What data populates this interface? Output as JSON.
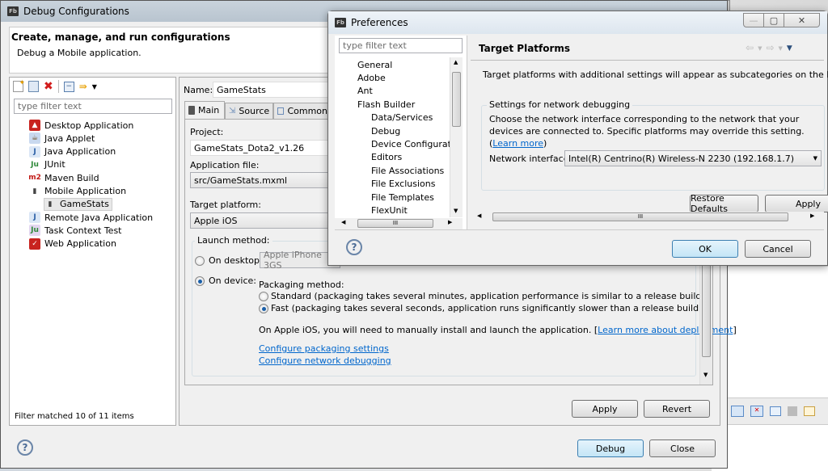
{
  "debug_window": {
    "title": "Debug Configurations",
    "header_title": "Create, manage, and run configurations",
    "header_subtitle": "Debug a Mobile application.",
    "filter_placeholder": "type filter text",
    "toolbar_icons": [
      "new-config-icon",
      "duplicate-icon",
      "delete-icon",
      "collapse-all-icon",
      "filter-icon",
      "dropdown-icon"
    ],
    "tree": [
      {
        "label": "Desktop Application",
        "icon": "desktop-app-icon",
        "level": 0
      },
      {
        "label": "Java Applet",
        "icon": "java-applet-icon",
        "level": 0
      },
      {
        "label": "Java Application",
        "icon": "java-app-icon",
        "level": 0
      },
      {
        "label": "JUnit",
        "icon": "junit-icon",
        "level": 0
      },
      {
        "label": "Maven Build",
        "icon": "maven-icon",
        "level": 0
      },
      {
        "label": "Mobile Application",
        "icon": "mobile-app-icon",
        "level": 0
      },
      {
        "label": "GameStats",
        "icon": "mobile-app-icon",
        "level": 1,
        "selected": true
      },
      {
        "label": "Remote Java Application",
        "icon": "remote-java-icon",
        "level": 0
      },
      {
        "label": "Task Context Test",
        "icon": "task-context-icon",
        "level": 0
      },
      {
        "label": "Web Application",
        "icon": "web-app-icon",
        "level": 0
      }
    ],
    "filter_status": "Filter matched 10 of 11 items",
    "name_label": "Name:",
    "name_value": "GameStats",
    "tabs": [
      {
        "label": "Main",
        "active": true
      },
      {
        "label": "Source",
        "active": false
      },
      {
        "label": "Common",
        "active": false
      }
    ],
    "project_label": "Project:",
    "project_value": "GameStats_Dota2_v1.26",
    "appfile_label": "Application file:",
    "appfile_value": "src/GameStats.mxml",
    "platform_label": "Target platform:",
    "platform_value": "Apple iOS",
    "launch_method_label": "Launch method:",
    "on_desktop_label": "On desktop:",
    "on_desktop_value": "Apple iPhone 3GS",
    "on_device_label": "On device:",
    "packaging_label": "Packaging method:",
    "standard_label": "Standard (packaging takes several minutes, application performance is similar to a release build)",
    "fast_label": "Fast (packaging takes several seconds, application runs significantly slower than a release build)",
    "ios_note": "On Apple iOS, you will need to manually install and launch the application. [",
    "ios_note_link": "Learn more about deployment",
    "ios_note_end": "]",
    "link_packaging": "Configure packaging settings",
    "link_network": "Configure network debugging",
    "apply_label": "Apply",
    "revert_label": "Revert",
    "debug_label": "Debug",
    "close_label": "Close",
    "help": "?"
  },
  "prefs_window": {
    "title": "Preferences",
    "filter_placeholder": "type filter text",
    "tree": [
      {
        "label": "General",
        "level": 0
      },
      {
        "label": "Adobe",
        "level": 0
      },
      {
        "label": "Ant",
        "level": 0
      },
      {
        "label": "Flash Builder",
        "level": 0
      },
      {
        "label": "Data/Services",
        "level": 1
      },
      {
        "label": "Debug",
        "level": 1
      },
      {
        "label": "Device Configuratio",
        "level": 1
      },
      {
        "label": "Editors",
        "level": 1
      },
      {
        "label": "File Associations",
        "level": 1
      },
      {
        "label": "File Exclusions",
        "level": 1
      },
      {
        "label": "File Templates",
        "level": 1
      },
      {
        "label": "FlexUnit",
        "level": 1
      }
    ],
    "page_title": "Target Platforms",
    "description": "Target platforms with additional settings will appear as subcategories on the left.",
    "group_label": "Settings for network debugging",
    "group_text": "Choose the network interface corresponding to the network that your devices are connected to. Specific platforms may override this setting. (",
    "learn_more": "Learn more",
    "group_text_end": ")",
    "network_label": "Network interface:",
    "network_value": "Intel(R) Centrino(R) Wireless-N 2230 (192.168.1.7)",
    "restore_label": "Restore Defaults",
    "apply_label": "Apply",
    "ok_label": "OK",
    "cancel_label": "Cancel",
    "help": "?",
    "scroll_grip": "III",
    "window_controls": {
      "minimize": "—",
      "maximize": "▢",
      "close": "✕"
    }
  },
  "background": {
    "close_glyph": "✕"
  }
}
